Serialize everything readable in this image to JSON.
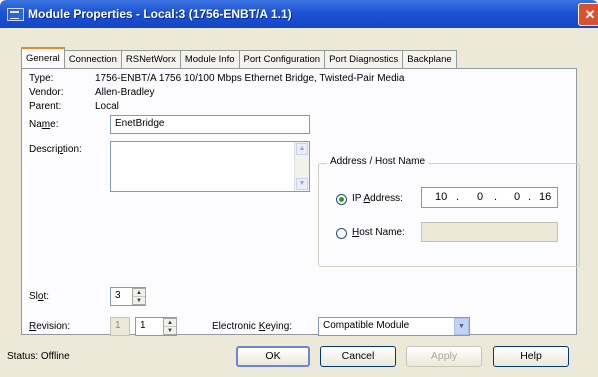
{
  "window": {
    "title": "Module Properties - Local:3 (1756-ENBT/A 1.1)",
    "close_glyph": "✕"
  },
  "tabs": [
    {
      "label": "General",
      "active": true
    },
    {
      "label": "Connection"
    },
    {
      "label": "RSNetWorx"
    },
    {
      "label": "Module Info"
    },
    {
      "label": "Port Configuration"
    },
    {
      "label": "Port Diagnostics"
    },
    {
      "label": "Backplane"
    }
  ],
  "general": {
    "type_label": "Type:",
    "type_value": "1756-ENBT/A 1756 10/100 Mbps Ethernet Bridge, Twisted-Pair Media",
    "vendor_label": "Vendor:",
    "vendor_value": "Allen-Bradley",
    "parent_label": "Parent:",
    "parent_value": "Local",
    "name_label_pre": "Na",
    "name_label_u": "m",
    "name_label_post": "e:",
    "name_value": "EnetBridge",
    "description_label_pre": "Descri",
    "description_label_u": "p",
    "description_label_post": "tion:",
    "description_value": "",
    "slot_label_pre": "Sl",
    "slot_label_u": "o",
    "slot_label_post": "t:",
    "slot_value": "3",
    "revision_label_pre": "",
    "revision_label_u": "R",
    "revision_label_post": "evision:",
    "revision_major": "1",
    "revision_minor": "1",
    "keying_label_pre": "Electronic ",
    "keying_label_u": "K",
    "keying_label_post": "eying:",
    "keying_value": "Compatible Module"
  },
  "address": {
    "group_title": "Address / Host Name",
    "ip_label_pre": "IP ",
    "ip_label_u": "A",
    "ip_label_post": "ddress:",
    "ip_octets": [
      "10",
      "0",
      "0",
      "16"
    ],
    "ip_selected": true,
    "host_label_pre": "",
    "host_label_u": "H",
    "host_label_post": "ost Name:",
    "host_value": ""
  },
  "status": {
    "text": "Status:  Offline"
  },
  "buttons": {
    "ok": "OK",
    "cancel": "Cancel",
    "apply": "Apply",
    "help": "Help"
  }
}
